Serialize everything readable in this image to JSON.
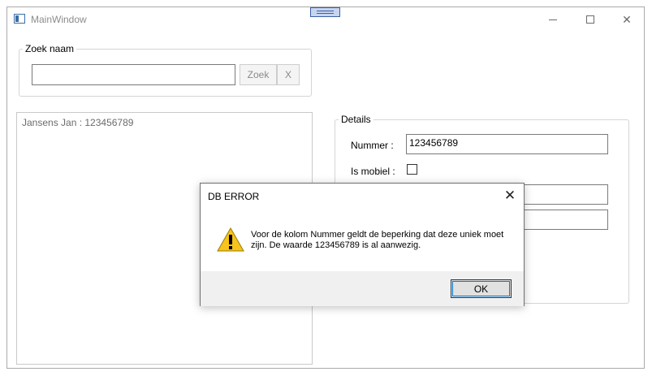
{
  "window": {
    "title": "MainWindow",
    "controls": {
      "minimize": "minimize-icon",
      "maximize": "maximize-icon",
      "close": "close-icon"
    }
  },
  "search": {
    "group_label": "Zoek naam",
    "input_value": "",
    "search_button": "Zoek",
    "clear_button": "X"
  },
  "list": {
    "items": [
      "Jansens Jan : 123456789"
    ]
  },
  "details": {
    "group_label": "Details",
    "nummer_label": "Nummer :",
    "nummer_value": "123456789",
    "mobiel_label": "Is mobiel :",
    "mobiel_checked": false
  },
  "dialog": {
    "title": "DB ERROR",
    "message": "Voor de kolom Nummer geldt de beperking dat deze uniek moet zijn. De waarde 123456789 is al aanwezig.",
    "ok_button": "OK",
    "icon": "warning-icon",
    "close_glyph": "✕"
  },
  "colors": {
    "accent": "#0078d7",
    "warning": "#f7c31c"
  }
}
